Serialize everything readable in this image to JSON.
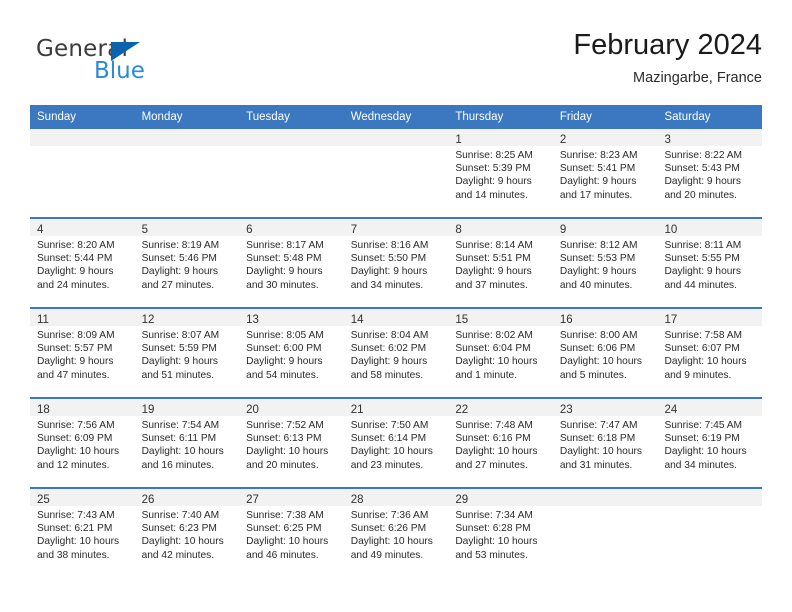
{
  "logo": {
    "primary_text": "General",
    "secondary_text": "Blue",
    "primary_color": "#3c3c3c",
    "secondary_color": "#2b8ad8",
    "triangle_color": "#0b63ae"
  },
  "header": {
    "title": "February 2024",
    "location": "Mazingarbe, France"
  },
  "theme": {
    "header_blue": "#3b78bf",
    "day_band_gray": "#f2f2f2"
  },
  "weekdays": [
    "Sunday",
    "Monday",
    "Tuesday",
    "Wednesday",
    "Thursday",
    "Friday",
    "Saturday"
  ],
  "weeks": [
    [
      {
        "day": "",
        "sunrise": "",
        "sunset": "",
        "daylight1": "",
        "daylight2": ""
      },
      {
        "day": "",
        "sunrise": "",
        "sunset": "",
        "daylight1": "",
        "daylight2": ""
      },
      {
        "day": "",
        "sunrise": "",
        "sunset": "",
        "daylight1": "",
        "daylight2": ""
      },
      {
        "day": "",
        "sunrise": "",
        "sunset": "",
        "daylight1": "",
        "daylight2": ""
      },
      {
        "day": "1",
        "sunrise": "Sunrise: 8:25 AM",
        "sunset": "Sunset: 5:39 PM",
        "daylight1": "Daylight: 9 hours",
        "daylight2": "and 14 minutes."
      },
      {
        "day": "2",
        "sunrise": "Sunrise: 8:23 AM",
        "sunset": "Sunset: 5:41 PM",
        "daylight1": "Daylight: 9 hours",
        "daylight2": "and 17 minutes."
      },
      {
        "day": "3",
        "sunrise": "Sunrise: 8:22 AM",
        "sunset": "Sunset: 5:43 PM",
        "daylight1": "Daylight: 9 hours",
        "daylight2": "and 20 minutes."
      }
    ],
    [
      {
        "day": "4",
        "sunrise": "Sunrise: 8:20 AM",
        "sunset": "Sunset: 5:44 PM",
        "daylight1": "Daylight: 9 hours",
        "daylight2": "and 24 minutes."
      },
      {
        "day": "5",
        "sunrise": "Sunrise: 8:19 AM",
        "sunset": "Sunset: 5:46 PM",
        "daylight1": "Daylight: 9 hours",
        "daylight2": "and 27 minutes."
      },
      {
        "day": "6",
        "sunrise": "Sunrise: 8:17 AM",
        "sunset": "Sunset: 5:48 PM",
        "daylight1": "Daylight: 9 hours",
        "daylight2": "and 30 minutes."
      },
      {
        "day": "7",
        "sunrise": "Sunrise: 8:16 AM",
        "sunset": "Sunset: 5:50 PM",
        "daylight1": "Daylight: 9 hours",
        "daylight2": "and 34 minutes."
      },
      {
        "day": "8",
        "sunrise": "Sunrise: 8:14 AM",
        "sunset": "Sunset: 5:51 PM",
        "daylight1": "Daylight: 9 hours",
        "daylight2": "and 37 minutes."
      },
      {
        "day": "9",
        "sunrise": "Sunrise: 8:12 AM",
        "sunset": "Sunset: 5:53 PM",
        "daylight1": "Daylight: 9 hours",
        "daylight2": "and 40 minutes."
      },
      {
        "day": "10",
        "sunrise": "Sunrise: 8:11 AM",
        "sunset": "Sunset: 5:55 PM",
        "daylight1": "Daylight: 9 hours",
        "daylight2": "and 44 minutes."
      }
    ],
    [
      {
        "day": "11",
        "sunrise": "Sunrise: 8:09 AM",
        "sunset": "Sunset: 5:57 PM",
        "daylight1": "Daylight: 9 hours",
        "daylight2": "and 47 minutes."
      },
      {
        "day": "12",
        "sunrise": "Sunrise: 8:07 AM",
        "sunset": "Sunset: 5:59 PM",
        "daylight1": "Daylight: 9 hours",
        "daylight2": "and 51 minutes."
      },
      {
        "day": "13",
        "sunrise": "Sunrise: 8:05 AM",
        "sunset": "Sunset: 6:00 PM",
        "daylight1": "Daylight: 9 hours",
        "daylight2": "and 54 minutes."
      },
      {
        "day": "14",
        "sunrise": "Sunrise: 8:04 AM",
        "sunset": "Sunset: 6:02 PM",
        "daylight1": "Daylight: 9 hours",
        "daylight2": "and 58 minutes."
      },
      {
        "day": "15",
        "sunrise": "Sunrise: 8:02 AM",
        "sunset": "Sunset: 6:04 PM",
        "daylight1": "Daylight: 10 hours",
        "daylight2": "and 1 minute."
      },
      {
        "day": "16",
        "sunrise": "Sunrise: 8:00 AM",
        "sunset": "Sunset: 6:06 PM",
        "daylight1": "Daylight: 10 hours",
        "daylight2": "and 5 minutes."
      },
      {
        "day": "17",
        "sunrise": "Sunrise: 7:58 AM",
        "sunset": "Sunset: 6:07 PM",
        "daylight1": "Daylight: 10 hours",
        "daylight2": "and 9 minutes."
      }
    ],
    [
      {
        "day": "18",
        "sunrise": "Sunrise: 7:56 AM",
        "sunset": "Sunset: 6:09 PM",
        "daylight1": "Daylight: 10 hours",
        "daylight2": "and 12 minutes."
      },
      {
        "day": "19",
        "sunrise": "Sunrise: 7:54 AM",
        "sunset": "Sunset: 6:11 PM",
        "daylight1": "Daylight: 10 hours",
        "daylight2": "and 16 minutes."
      },
      {
        "day": "20",
        "sunrise": "Sunrise: 7:52 AM",
        "sunset": "Sunset: 6:13 PM",
        "daylight1": "Daylight: 10 hours",
        "daylight2": "and 20 minutes."
      },
      {
        "day": "21",
        "sunrise": "Sunrise: 7:50 AM",
        "sunset": "Sunset: 6:14 PM",
        "daylight1": "Daylight: 10 hours",
        "daylight2": "and 23 minutes."
      },
      {
        "day": "22",
        "sunrise": "Sunrise: 7:48 AM",
        "sunset": "Sunset: 6:16 PM",
        "daylight1": "Daylight: 10 hours",
        "daylight2": "and 27 minutes."
      },
      {
        "day": "23",
        "sunrise": "Sunrise: 7:47 AM",
        "sunset": "Sunset: 6:18 PM",
        "daylight1": "Daylight: 10 hours",
        "daylight2": "and 31 minutes."
      },
      {
        "day": "24",
        "sunrise": "Sunrise: 7:45 AM",
        "sunset": "Sunset: 6:19 PM",
        "daylight1": "Daylight: 10 hours",
        "daylight2": "and 34 minutes."
      }
    ],
    [
      {
        "day": "25",
        "sunrise": "Sunrise: 7:43 AM",
        "sunset": "Sunset: 6:21 PM",
        "daylight1": "Daylight: 10 hours",
        "daylight2": "and 38 minutes."
      },
      {
        "day": "26",
        "sunrise": "Sunrise: 7:40 AM",
        "sunset": "Sunset: 6:23 PM",
        "daylight1": "Daylight: 10 hours",
        "daylight2": "and 42 minutes."
      },
      {
        "day": "27",
        "sunrise": "Sunrise: 7:38 AM",
        "sunset": "Sunset: 6:25 PM",
        "daylight1": "Daylight: 10 hours",
        "daylight2": "and 46 minutes."
      },
      {
        "day": "28",
        "sunrise": "Sunrise: 7:36 AM",
        "sunset": "Sunset: 6:26 PM",
        "daylight1": "Daylight: 10 hours",
        "daylight2": "and 49 minutes."
      },
      {
        "day": "29",
        "sunrise": "Sunrise: 7:34 AM",
        "sunset": "Sunset: 6:28 PM",
        "daylight1": "Daylight: 10 hours",
        "daylight2": "and 53 minutes."
      },
      {
        "day": "",
        "sunrise": "",
        "sunset": "",
        "daylight1": "",
        "daylight2": ""
      },
      {
        "day": "",
        "sunrise": "",
        "sunset": "",
        "daylight1": "",
        "daylight2": ""
      }
    ]
  ]
}
